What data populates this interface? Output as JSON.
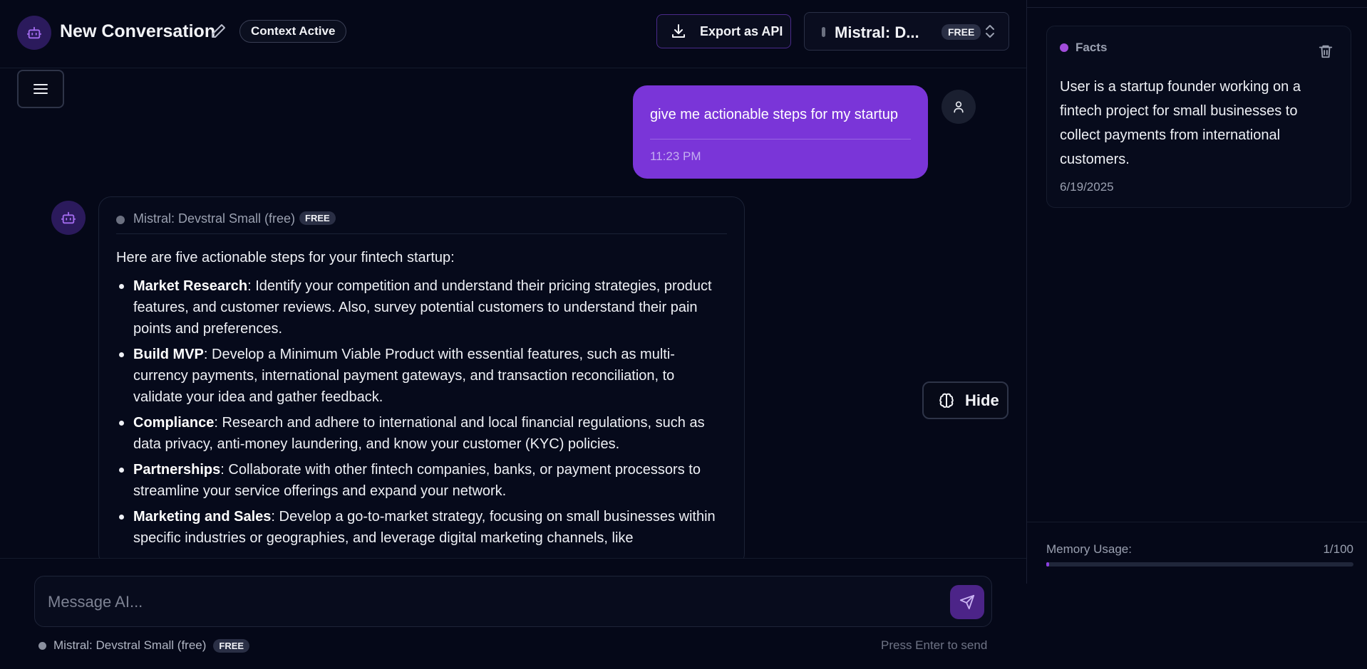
{
  "header": {
    "title": "New Conversation",
    "context_pill": "Context Active",
    "export_label": "Export as API",
    "model_short": "Mistral: D...",
    "model_badge": "FREE"
  },
  "messages": {
    "user": {
      "text": "give me actionable steps for my startup",
      "time": "11:23 PM"
    },
    "assistant": {
      "model_name": "Mistral: Devstral Small (free)",
      "badge": "FREE",
      "intro": "Here are five actionable steps for your fintech startup:",
      "steps": [
        {
          "title": "Market Research",
          "text": ": Identify your competition and understand their pricing strategies, product features, and customer reviews. Also, survey potential customers to understand their pain points and preferences."
        },
        {
          "title": "Build MVP",
          "text": ": Develop a Minimum Viable Product with essential features, such as multi-currency payments, international payment gateways, and transaction reconciliation, to validate your idea and gather feedback."
        },
        {
          "title": "Compliance",
          "text": ": Research and adhere to international and local financial regulations, such as data privacy, anti-money laundering, and know your customer (KYC) policies."
        },
        {
          "title": "Partnerships",
          "text": ": Collaborate with other fintech companies, banks, or payment processors to streamline your service offerings and expand your network."
        },
        {
          "title": "Marketing and Sales",
          "text": ": Develop a go-to-market strategy, focusing on small businesses within specific industries or geographies, and leverage digital marketing channels, like"
        }
      ]
    }
  },
  "memory_toggle": {
    "label": "Hide",
    "icon": "brain-icon"
  },
  "composer": {
    "placeholder": "Message AI...",
    "model_name": "Mistral: Devstral Small (free)",
    "badge": "FREE",
    "hint": "Press Enter to send"
  },
  "sidebar": {
    "facts": [
      {
        "category": "Facts",
        "content": "User is a startup founder working on a fintech project for small businesses to collect payments from international customers.",
        "date": "6/19/2025"
      }
    ],
    "memory_usage": {
      "label": "Memory Usage:",
      "count": "1/100",
      "fraction": 0.01
    }
  },
  "colors": {
    "background": "#050818",
    "accent": "#7a35d8",
    "fact_dot": "#a24ddb"
  }
}
